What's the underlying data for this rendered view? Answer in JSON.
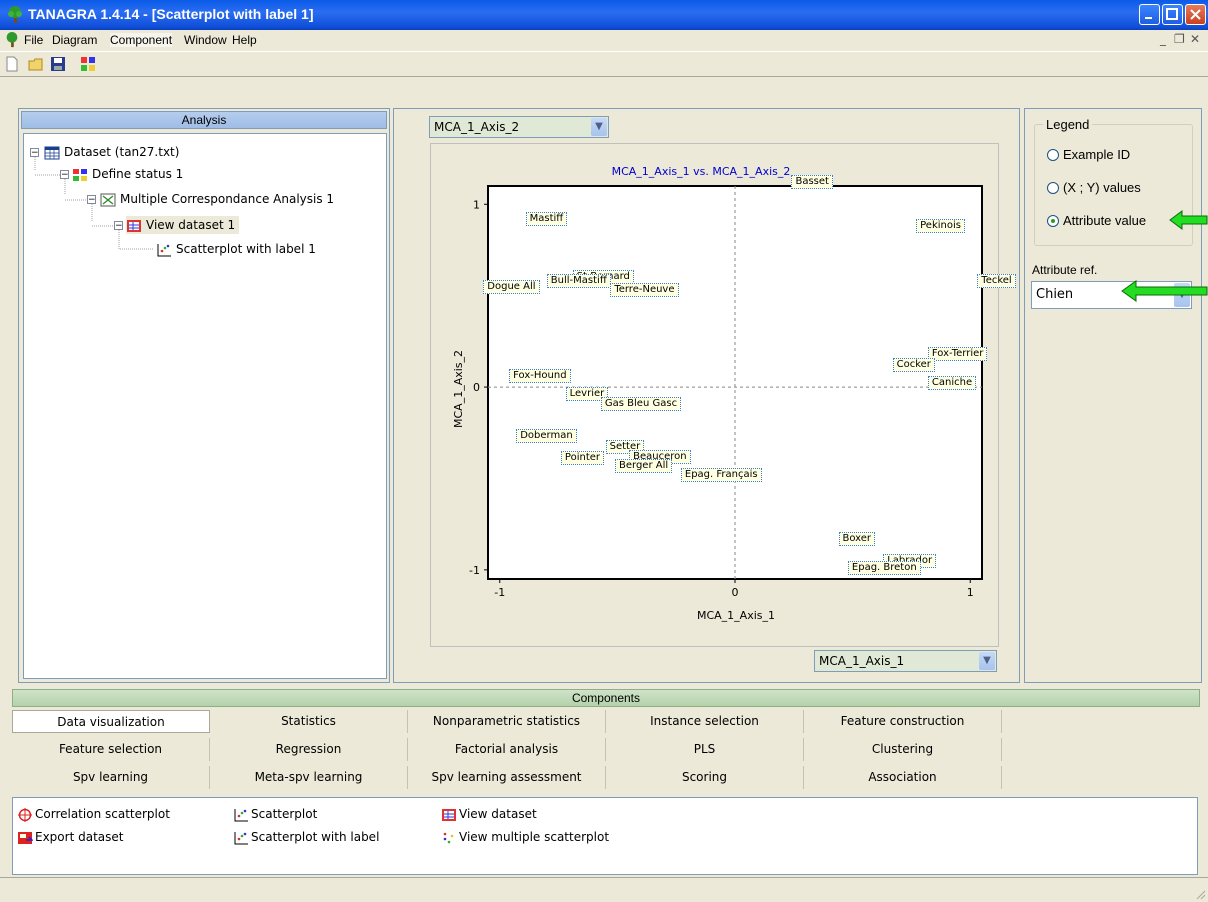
{
  "window": {
    "title": "TANAGRA 1.4.14 - [Scatterplot with label 1]"
  },
  "menu": [
    "File",
    "Diagram",
    "Component",
    "Window",
    "Help"
  ],
  "toolbar": {
    "icons": [
      "new-icon",
      "open-icon",
      "save-icon",
      "diagram-icon"
    ]
  },
  "analysis": {
    "header": "Analysis",
    "tree": [
      {
        "label": "Dataset (tan27.txt)",
        "icon": "dataset-icon"
      },
      {
        "label": "Define status 1",
        "icon": "status-icon"
      },
      {
        "label": "Multiple Correspondance Analysis 1",
        "icon": "mca-icon"
      },
      {
        "label": "View dataset 1",
        "icon": "view-dataset-icon"
      },
      {
        "label": "Scatterplot with label 1",
        "icon": "scatter-icon"
      }
    ]
  },
  "plot": {
    "y_select": "MCA_1_Axis_2",
    "x_select": "MCA_1_Axis_1"
  },
  "chart_data": {
    "type": "scatter",
    "title": "MCA_1_Axis_1 vs. MCA_1_Axis_2",
    "xlabel": "MCA_1_Axis_1",
    "ylabel": "MCA_1_Axis_2",
    "xlim": [
      -1.05,
      1.05
    ],
    "ylim": [
      -1.05,
      1.1
    ],
    "xticks": [
      "-1",
      "0",
      "1"
    ],
    "yticks": [
      "1",
      "0",
      "-1"
    ],
    "xtick_values": [
      -1,
      0,
      1
    ],
    "ytick_values": [
      1,
      0,
      -1
    ],
    "grid": "dashed lines at 0",
    "points": [
      {
        "label": "Basset",
        "x": 0.24,
        "y": 1.12
      },
      {
        "label": "Mastiff",
        "x": -0.89,
        "y": 0.92
      },
      {
        "label": "Pekinois",
        "x": 0.77,
        "y": 0.88
      },
      {
        "label": "St-Bernard",
        "x": -0.69,
        "y": 0.6
      },
      {
        "label": "Bull-Mastiff",
        "x": -0.8,
        "y": 0.58
      },
      {
        "label": "Dogue All",
        "x": -1.07,
        "y": 0.55
      },
      {
        "label": "Terre-Neuve",
        "x": -0.53,
        "y": 0.53
      },
      {
        "label": "Teckel",
        "x": 1.03,
        "y": 0.58
      },
      {
        "label": "Fox-Terrier",
        "x": 0.82,
        "y": 0.18
      },
      {
        "label": "Cocker",
        "x": 0.67,
        "y": 0.12
      },
      {
        "label": "Caniche",
        "x": 0.82,
        "y": 0.02
      },
      {
        "label": "Fox-Hound",
        "x": -0.96,
        "y": 0.06
      },
      {
        "label": "Levrier",
        "x": -0.72,
        "y": -0.04
      },
      {
        "label": "Gas Bleu Gasc",
        "x": -0.57,
        "y": -0.09
      },
      {
        "label": "Doberman",
        "x": -0.93,
        "y": -0.27
      },
      {
        "label": "Setter",
        "x": -0.55,
        "y": -0.33
      },
      {
        "label": "Beauceron",
        "x": -0.45,
        "y": -0.38
      },
      {
        "label": "Pointer",
        "x": -0.74,
        "y": -0.39
      },
      {
        "label": "Berger All",
        "x": -0.51,
        "y": -0.43
      },
      {
        "label": "Epag. Français",
        "x": -0.23,
        "y": -0.48
      },
      {
        "label": "Boxer",
        "x": 0.44,
        "y": -0.83
      },
      {
        "label": "Labrador",
        "x": 0.63,
        "y": -0.95
      },
      {
        "label": "Epag. Breton",
        "x": 0.48,
        "y": -0.99
      }
    ]
  },
  "legend": {
    "title": "Legend",
    "options": [
      "Example ID",
      "(X ; Y) values",
      "Attribute value"
    ],
    "selected": 2,
    "attr_ref_label": "Attribute ref.",
    "attr_ref_value": "Chien"
  },
  "components": {
    "header": "Components",
    "tabs": [
      [
        "Data visualization",
        "Statistics",
        "Nonparametric statistics",
        "Instance selection",
        "Feature construction"
      ],
      [
        "Feature selection",
        "Regression",
        "Factorial analysis",
        "PLS",
        "Clustering"
      ],
      [
        "Spv learning",
        "Meta-spv learning",
        "Spv learning assessment",
        "Scoring",
        "Association"
      ]
    ],
    "items": [
      {
        "label": "Correlation scatterplot",
        "icon": "correlation-icon"
      },
      {
        "label": "Scatterplot",
        "icon": "scatter-icon"
      },
      {
        "label": "View dataset",
        "icon": "view-dataset-icon"
      },
      {
        "label": "Export dataset",
        "icon": "export-icon"
      },
      {
        "label": "Scatterplot with label",
        "icon": "scatter-label-icon"
      },
      {
        "label": "View multiple scatterplot",
        "icon": "multi-scatter-icon"
      }
    ]
  },
  "colors": {
    "title_blue": "#0a5be8",
    "chart_title": "#0000cc",
    "label_bg": "#ffffe1",
    "arrow_green": "#22cc22"
  }
}
